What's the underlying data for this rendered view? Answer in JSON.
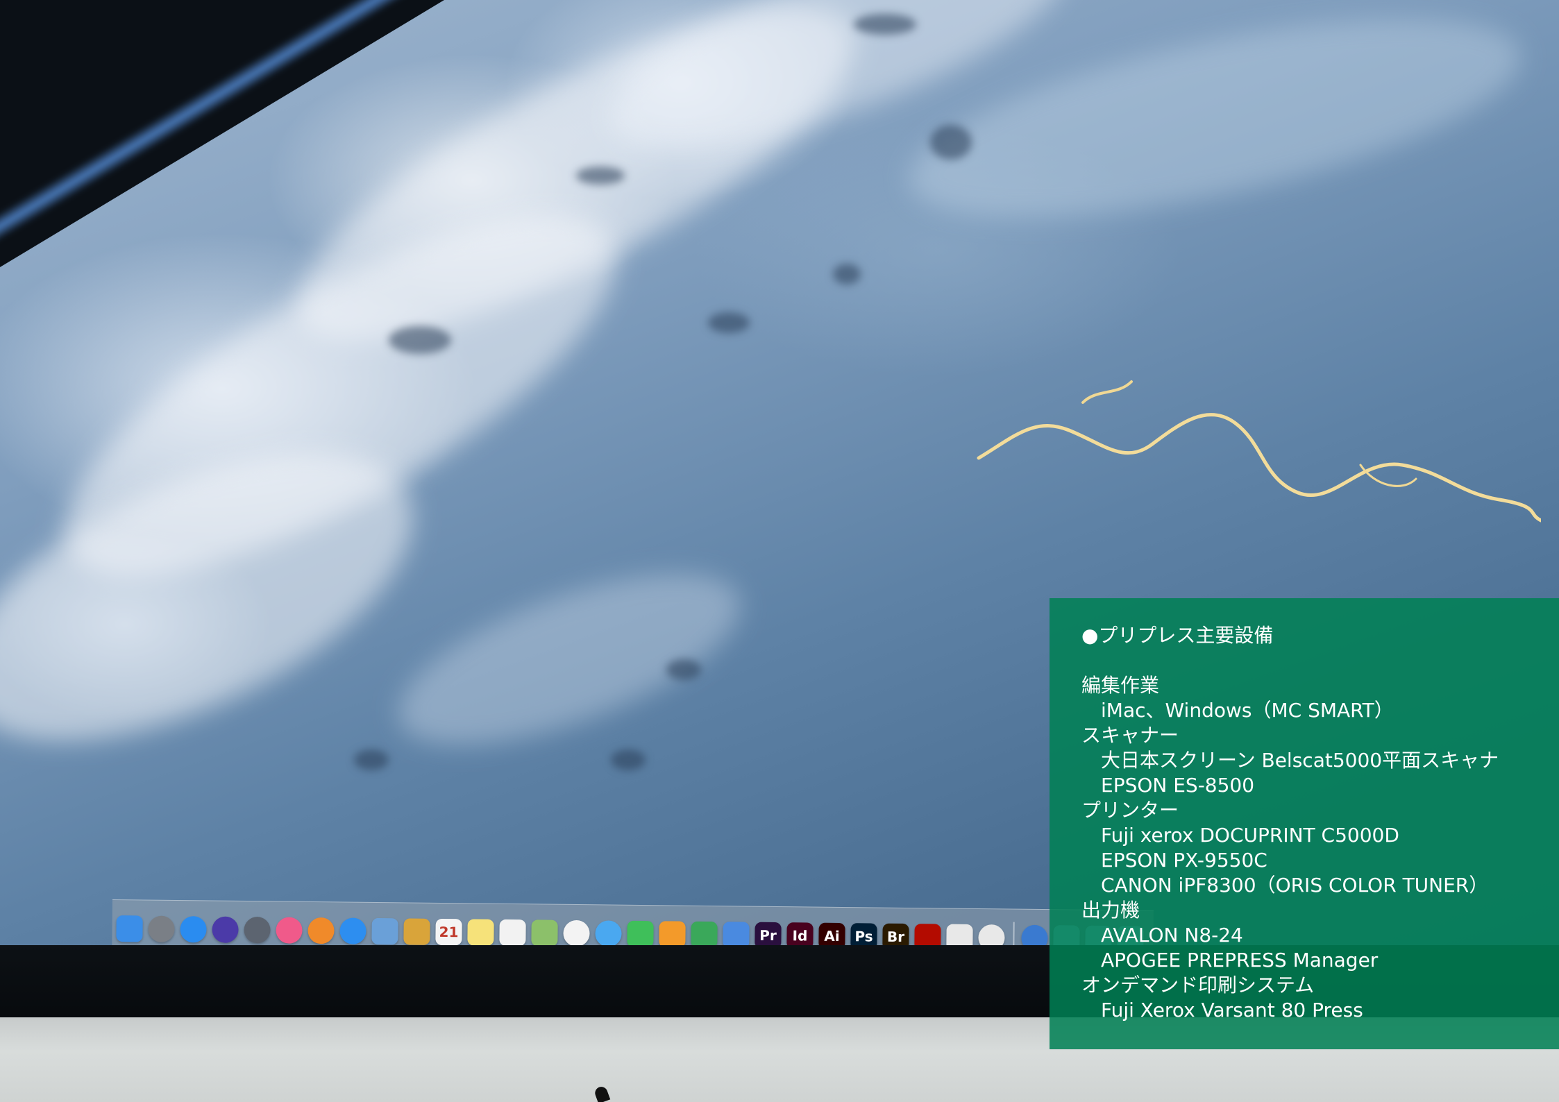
{
  "panel": {
    "title": "●プリプレス主要設備",
    "sections": [
      {
        "heading": "編集作業",
        "items": [
          "iMac、Windows（MC SMART）"
        ]
      },
      {
        "heading": "スキャナー",
        "items": [
          "大日本スクリーン Belscat5000平面スキャナ",
          "EPSON ES-8500"
        ]
      },
      {
        "heading": "プリンター",
        "items": [
          "Fuji xerox DOCUPRINT C5000D",
          "EPSON PX-9550C",
          "CANON iPF8300（ORIS COLOR TUNER）"
        ]
      },
      {
        "heading": "出力機",
        "items": [
          "AVALON N8-24",
          "APOGEE PREPRESS Manager"
        ]
      },
      {
        "heading": "オンデマンド印刷システム",
        "items": [
          "Fuji Xerox Varsant 80 Press"
        ]
      }
    ]
  },
  "dock": {
    "apps": [
      {
        "label": "",
        "icon": "finder-icon",
        "color": "#3b8ee8"
      },
      {
        "label": "",
        "icon": "system-preferences-icon",
        "color": "#7a7f86"
      },
      {
        "label": "",
        "icon": "app-store-icon",
        "color": "#2a8cf0"
      },
      {
        "label": "",
        "icon": "siri-icon",
        "color": "#4b3aa8"
      },
      {
        "label": "",
        "icon": "launchpad-icon",
        "color": "#5c6470"
      },
      {
        "label": "",
        "icon": "itunes-icon",
        "color": "#f05a8a"
      },
      {
        "label": "",
        "icon": "ibooks-icon",
        "color": "#f08a2a"
      },
      {
        "label": "",
        "icon": "safari-icon",
        "color": "#2d8ef0"
      },
      {
        "label": "",
        "icon": "preview-icon",
        "color": "#6aa0d8"
      },
      {
        "label": "",
        "icon": "notes-folder-icon",
        "color": "#d9a43a"
      },
      {
        "label": "21",
        "icon": "calendar-icon",
        "color": "#f4f4f4"
      },
      {
        "label": "",
        "icon": "notes-icon",
        "color": "#f6e27a"
      },
      {
        "label": "",
        "icon": "reminders-icon",
        "color": "#f2f2f2"
      },
      {
        "label": "",
        "icon": "maps-icon",
        "color": "#8cc06a"
      },
      {
        "label": "",
        "icon": "photos-icon",
        "color": "#f3f3f3"
      },
      {
        "label": "",
        "icon": "messages-icon",
        "color": "#4aa8f0"
      },
      {
        "label": "",
        "icon": "facetime-icon",
        "color": "#3fbf5a"
      },
      {
        "label": "",
        "icon": "pages-icon",
        "color": "#f39a2a"
      },
      {
        "label": "",
        "icon": "numbers-icon",
        "color": "#3aa85a"
      },
      {
        "label": "",
        "icon": "keynote-icon",
        "color": "#4a8ae0"
      },
      {
        "label": "Pr",
        "icon": "premiere-icon",
        "color": "#2a0f3e"
      },
      {
        "label": "Id",
        "icon": "indesign-icon",
        "color": "#49021f"
      },
      {
        "label": "Ai",
        "icon": "illustrator-icon",
        "color": "#330000"
      },
      {
        "label": "Ps",
        "icon": "photoshop-icon",
        "color": "#001e36"
      },
      {
        "label": "Br",
        "icon": "bridge-icon",
        "color": "#2a1a00"
      },
      {
        "label": "",
        "icon": "acrobat-icon",
        "color": "#b30b00"
      },
      {
        "label": "",
        "icon": "font-book-icon",
        "color": "#e8e8e8"
      },
      {
        "label": "",
        "icon": "chrome-icon",
        "color": "#e8e8e8"
      }
    ],
    "trailing": [
      {
        "label": "",
        "icon": "globe-icon",
        "color": "#3a7ad0"
      },
      {
        "label": "",
        "icon": "folder-icon",
        "color": "#8fc2ea"
      },
      {
        "label": "",
        "icon": "folder-icon",
        "color": "#8fc2ea"
      },
      {
        "label": "",
        "icon": "folder-icon",
        "color": "#8fc2ea"
      }
    ]
  },
  "colors": {
    "panel_green": "#008054",
    "panel_text": "#ffffff"
  }
}
